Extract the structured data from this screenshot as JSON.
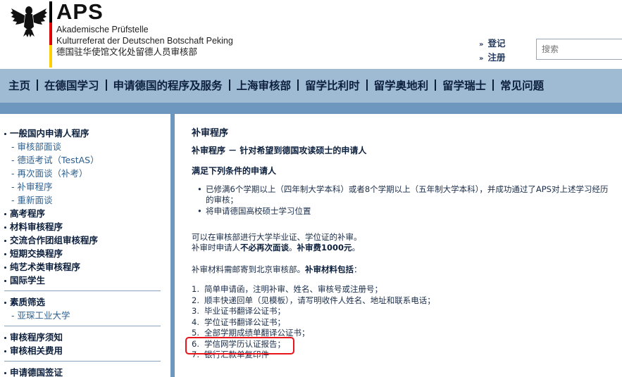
{
  "header": {
    "logo_text": "APS",
    "line1": "Akademische Prüfstelle",
    "line2": "Kulturreferat der Deutschen Botschaft Peking",
    "line3": "德国驻华使馆文化处留德人员审核部",
    "links": [
      {
        "label": "登记"
      },
      {
        "label": "注册"
      }
    ],
    "search_placeholder": "搜索"
  },
  "nav": {
    "items": [
      {
        "label": "主页"
      },
      {
        "label": "在德国学习"
      },
      {
        "label": "申请德国的程序及服务"
      },
      {
        "label": "上海审核部"
      },
      {
        "label": "留学比利时"
      },
      {
        "label": "留学奥地利"
      },
      {
        "label": "留学瑞士"
      },
      {
        "label": "常见问题"
      }
    ]
  },
  "sidebar": {
    "group1": {
      "title": "一般国内申请人程序",
      "subs": [
        {
          "label": "审核部面谈"
        },
        {
          "label": "德适考试（TestAS）"
        },
        {
          "label": "再次面谈（补考）"
        },
        {
          "label": "补审程序"
        },
        {
          "label": "重新面谈"
        }
      ]
    },
    "group2": [
      {
        "label": "高考程序"
      },
      {
        "label": "材料审核程序"
      },
      {
        "label": "交流合作团组审核程序"
      },
      {
        "label": "短期交换程序"
      },
      {
        "label": "纯艺术类审核程序"
      },
      {
        "label": "国际学生"
      }
    ],
    "group3": {
      "title": "素质筛选",
      "subs": [
        {
          "label": "亚琛工业大学"
        }
      ]
    },
    "group4": [
      {
        "label": "审核程序须知"
      },
      {
        "label": "审核相关费用"
      }
    ],
    "group5": [
      {
        "label": "申请德国签证"
      }
    ]
  },
  "content": {
    "title": "补审程序",
    "subtitle": "补审程序  －  针对希望到德国攻读硕士的申请人",
    "conditions_title": "满足下列条件的申请人",
    "bullets": [
      "已修满6个学期以上（四年制大学本科）或者8个学期以上（五年制大学本科），并成功通过了APS对上述学习经历的审核；",
      "将申请德国高校硕士学习位置"
    ],
    "para1_line1": "可以在审核部进行大学毕业证、学位证的补审。",
    "para1_line2_a": "补审时申请人",
    "para1_line2_b": "不必再次面谈",
    "para1_line2_c": "。",
    "para1_line2_d": "补审费1000元",
    "para1_line2_e": "。",
    "para2_a": "补审材料需邮寄到北京审核部。",
    "para2_b": "补审材料包括",
    "para2_c": "：",
    "materials": [
      {
        "num": "1.",
        "text": "简单申请函，注明补审、姓名、审核号或注册号；"
      },
      {
        "num": "2.",
        "text": "顺丰快递回单（见模板），请写明收件人姓名、地址和联系电话；"
      },
      {
        "num": "3.",
        "text": "毕业证书翻译公证书；"
      },
      {
        "num": "4.",
        "text": "学位证书翻译公证书；"
      },
      {
        "num": "5.",
        "text": "全部学期成绩单翻译公证书；"
      },
      {
        "num": "6.",
        "text": "学信网学历认证报告；"
      },
      {
        "num": "7.",
        "text": "银行汇款单复印件"
      }
    ]
  }
}
